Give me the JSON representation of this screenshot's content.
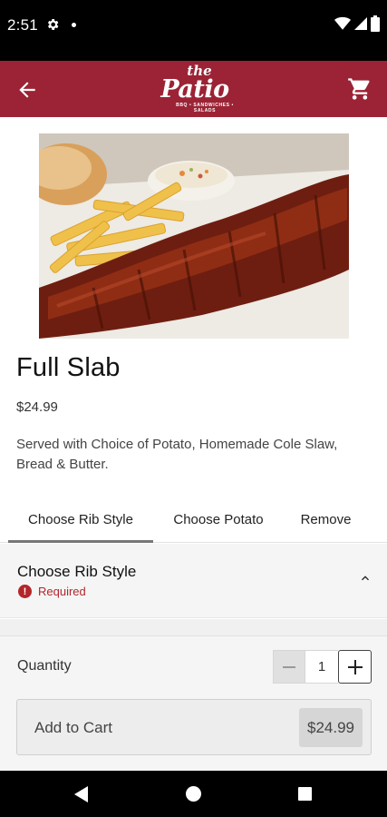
{
  "status_bar": {
    "time": "2:51",
    "icons": [
      "gear-icon",
      "notification-dot-icon",
      "wifi-icon",
      "signal-icon",
      "battery-icon"
    ]
  },
  "app_bar": {
    "logo": {
      "the": "the",
      "patio": "Patio",
      "tagline": "BBQ • SANDWICHES • SALADS"
    },
    "back_icon": "arrow-back-icon",
    "cart_icon": "cart-icon",
    "color": "#9b2335"
  },
  "item": {
    "title": "Full Slab",
    "price": "$24.99",
    "description": "Served with Choice of Potato, Homemade Cole Slaw, Bread & Butter."
  },
  "tabs": [
    {
      "label": "Choose Rib Style",
      "active": true
    },
    {
      "label": "Choose Potato",
      "active": false
    },
    {
      "label": "Remove",
      "active": false
    }
  ],
  "section": {
    "title": "Choose Rib Style",
    "required_label": "Required",
    "expanded": true
  },
  "bottom": {
    "quantity_label": "Quantity",
    "quantity_value": "1",
    "add_to_cart_label": "Add to Cart",
    "add_to_cart_price": "$24.99"
  },
  "colors": {
    "brand": "#9b2335",
    "required": "#b3262a"
  }
}
